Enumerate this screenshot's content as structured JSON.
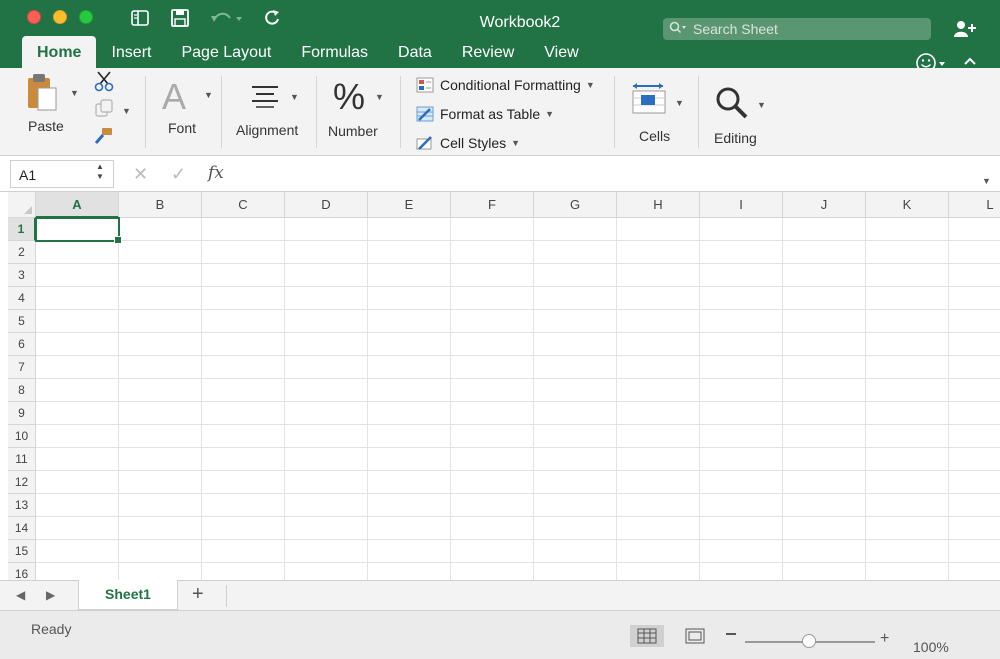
{
  "window": {
    "title": "Workbook2"
  },
  "search": {
    "placeholder": "Search Sheet"
  },
  "tabs": [
    {
      "label": "Home",
      "active": true
    },
    {
      "label": "Insert"
    },
    {
      "label": "Page Layout"
    },
    {
      "label": "Formulas"
    },
    {
      "label": "Data"
    },
    {
      "label": "Review"
    },
    {
      "label": "View"
    }
  ],
  "ribbon": {
    "paste": "Paste",
    "font": "Font",
    "alignment": "Alignment",
    "number": "Number",
    "conditional_formatting": "Conditional Formatting",
    "format_as_table": "Format as Table",
    "cell_styles": "Cell Styles",
    "cells": "Cells",
    "editing": "Editing",
    "font_glyph": "A",
    "number_glyph": "%"
  },
  "formula_bar": {
    "name_box": "A1",
    "fx": "fx",
    "cancel": "✕",
    "enter": "✓",
    "value": ""
  },
  "grid": {
    "columns": [
      "A",
      "B",
      "C",
      "D",
      "E",
      "F",
      "G",
      "H",
      "I",
      "J",
      "K",
      "L"
    ],
    "rows": [
      "1",
      "2",
      "3",
      "4",
      "5",
      "6",
      "7",
      "8",
      "9",
      "10",
      "11",
      "12",
      "13",
      "14",
      "15",
      "16"
    ],
    "active_cell": "A1"
  },
  "sheets": {
    "tabs": [
      "Sheet1"
    ],
    "add": "+",
    "prev": "◀",
    "next": "▶"
  },
  "status": {
    "text": "Ready",
    "zoom": "100%",
    "zoom_plus": "+"
  },
  "colors": {
    "brand": "#217346",
    "ribbon_bg": "#f3f3f3"
  },
  "icons": {
    "undo": "undo-icon",
    "redo": "redo-icon",
    "save": "save-icon",
    "sidebar": "sidebar-toggle-icon",
    "search": "search-icon",
    "add_user": "add-user-icon",
    "smiley": "smiley-icon",
    "collapse": "chevron-up-icon"
  }
}
